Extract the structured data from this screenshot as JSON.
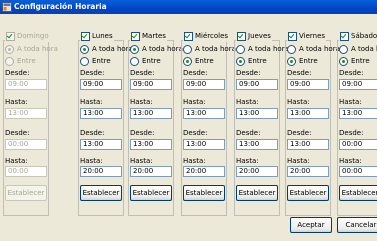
{
  "window": {
    "title": "Configuración Horaria"
  },
  "days": [
    {
      "label": "Domingo",
      "enabled": false,
      "full_day": true,
      "radio_full": "A toda hora",
      "radio_range": "Entre",
      "from_label": "Desde:",
      "to_label": "Hasta:",
      "from1": "09:00",
      "to1": "13:00",
      "from2": "00:00",
      "to2": "00:00",
      "button": "Establecer"
    },
    {
      "label": "Lunes",
      "enabled": true,
      "full_day": true,
      "radio_full": "A toda hora",
      "radio_range": "Entre",
      "from_label": "Desde:",
      "to_label": "Hasta:",
      "from1": "09:00",
      "to1": "13:00",
      "from2": "13:00",
      "to2": "20:00",
      "button": "Establecer"
    },
    {
      "label": "Martes",
      "enabled": true,
      "full_day": true,
      "radio_full": "A toda hora",
      "radio_range": "Entre",
      "from_label": "Desde:",
      "to_label": "Hasta:",
      "from1": "09:00",
      "to1": "13:00",
      "from2": "13:00",
      "to2": "20:00",
      "button": "Establecer"
    },
    {
      "label": "Miércoles",
      "enabled": true,
      "full_day": false,
      "radio_full": "A toda hora",
      "radio_range": "Entre",
      "from_label": "Desde:",
      "to_label": "Hasta:",
      "from1": "09:00",
      "to1": "13:00",
      "from2": "13:00",
      "to2": "20:00",
      "button": "Establecer"
    },
    {
      "label": "Jueves",
      "enabled": true,
      "full_day": false,
      "radio_full": "A toda hora",
      "radio_range": "Entre",
      "from_label": "Desde:",
      "to_label": "Hasta:",
      "from1": "09:00",
      "to1": "13:00",
      "from2": "13:00",
      "to2": "20:00",
      "button": "Establecer"
    },
    {
      "label": "Viernes",
      "enabled": true,
      "full_day": false,
      "radio_full": "A toda hora",
      "radio_range": "Entre",
      "from_label": "Desde:",
      "to_label": "Hasta:",
      "from1": "09:00",
      "to1": "13:00",
      "from2": "13:00",
      "to2": "20:00",
      "button": "Establecer"
    },
    {
      "label": "Sábado",
      "enabled": true,
      "full_day": false,
      "radio_full": "A toda hora",
      "radio_range": "Entre",
      "from_label": "Desde:",
      "to_label": "Hasta:",
      "from1": "09:00",
      "to1": "13:00",
      "from2": "00:00",
      "to2": "00:00",
      "button": "Establecer"
    }
  ],
  "footer": {
    "accept": "Aceptar",
    "cancel": "Cancelar"
  }
}
